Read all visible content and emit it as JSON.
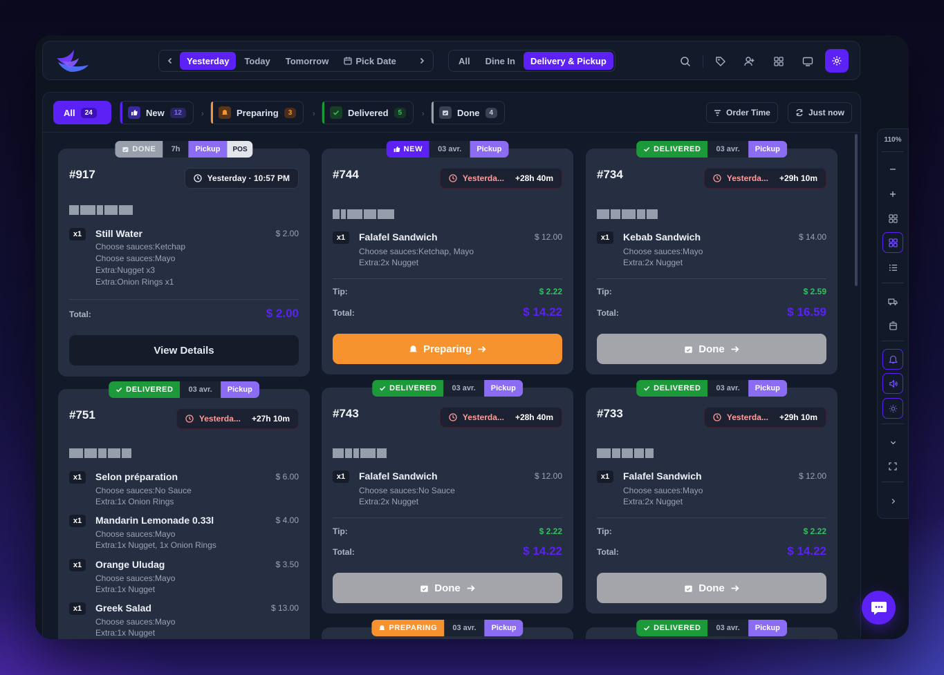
{
  "topbar": {
    "days": [
      {
        "label": "Yesterday",
        "active": true
      },
      {
        "label": "Today",
        "active": false
      },
      {
        "label": "Tomorrow",
        "active": false
      }
    ],
    "pick_date": "Pick Date",
    "modes": [
      {
        "label": "All",
        "active": false
      },
      {
        "label": "Dine In",
        "active": false
      },
      {
        "label": "Delivery & Pickup",
        "active": true
      }
    ]
  },
  "filters": {
    "all": {
      "label": "All",
      "count": "24"
    },
    "tabs": [
      {
        "label": "New",
        "count": "12",
        "color": "#5b21f5"
      },
      {
        "label": "Preparing",
        "count": "3",
        "color": "#f7932e"
      },
      {
        "label": "Delivered",
        "count": "5",
        "color": "#1c9a3a"
      },
      {
        "label": "Done",
        "count": "4",
        "color": "#9aa0ab"
      }
    ],
    "order_time": "Order Time",
    "just_now": "Just now"
  },
  "sidebar": {
    "zoom": "110%"
  },
  "cards": [
    {
      "number": "#917",
      "tags": {
        "status": "DONE",
        "time": "7h",
        "type": "Pickup",
        "source": "POS"
      },
      "time_label": "Yesterday · 10:57 PM",
      "items": [
        {
          "qty": "x1",
          "name": "Still Water",
          "price": "$ 2.00",
          "mods": [
            "Choose sauces:Ketchap",
            "Choose sauces:Mayo",
            "Extra:Nugget x3",
            "Extra:Onion Rings x1"
          ]
        }
      ],
      "total_label": "Total:",
      "total": "$ 2.00",
      "action": "View Details"
    },
    {
      "number": "#744",
      "tags": {
        "status": "NEW",
        "time": "03 avr.",
        "type": "Pickup"
      },
      "time_label": "Yesterda...",
      "late": "+28h 40m",
      "items": [
        {
          "qty": "x1",
          "name": "Falafel Sandwich",
          "price": "$ 12.00",
          "mods": [
            "Choose sauces:Ketchap, Mayo",
            "Extra:2x Nugget"
          ]
        }
      ],
      "tip_label": "Tip:",
      "tip": "$ 2.22",
      "total_label": "Total:",
      "total": "$ 14.22",
      "action": "Preparing"
    },
    {
      "number": "#734",
      "tags": {
        "status": "DELIVERED",
        "time": "03 avr.",
        "type": "Pickup"
      },
      "time_label": "Yesterda...",
      "late": "+29h 10m",
      "items": [
        {
          "qty": "x1",
          "name": "Kebab Sandwich",
          "price": "$ 14.00",
          "mods": [
            "Choose sauces:Mayo",
            "Extra:2x Nugget"
          ]
        }
      ],
      "tip_label": "Tip:",
      "tip": "$ 2.59",
      "total_label": "Total:",
      "total": "$ 16.59",
      "action": "Done"
    },
    {
      "number": "#751",
      "tags": {
        "status": "DELIVERED",
        "time": "03 avr.",
        "type": "Pickup"
      },
      "time_label": "Yesterda...",
      "late": "+27h 10m",
      "items": [
        {
          "qty": "x1",
          "name": "Selon préparation",
          "price": "$ 6.00",
          "mods": [
            "Choose sauces:No Sauce",
            "Extra:1x Onion Rings"
          ]
        },
        {
          "qty": "x1",
          "name": "Mandarin Lemonade 0.33l",
          "price": "$ 4.00",
          "mods": [
            "Choose sauces:Mayo",
            "Extra:1x Nugget, 1x Onion Rings"
          ]
        },
        {
          "qty": "x1",
          "name": "Orange Uludag",
          "price": "$ 3.50",
          "mods": [
            "Choose sauces:Mayo",
            "Extra:1x Nugget"
          ]
        },
        {
          "qty": "x1",
          "name": "Greek Salad",
          "price": "$ 13.00",
          "mods": [
            "Choose sauces:Mayo",
            "Extra:1x Nugget"
          ]
        }
      ]
    },
    {
      "number": "#743",
      "tags": {
        "status": "DELIVERED",
        "time": "03 avr.",
        "type": "Pickup"
      },
      "time_label": "Yesterda...",
      "late": "+28h 40m",
      "items": [
        {
          "qty": "x1",
          "name": "Falafel Sandwich",
          "price": "$ 12.00",
          "mods": [
            "Choose sauces:No Sauce",
            "Extra:2x Nugget"
          ]
        }
      ],
      "tip_label": "Tip:",
      "tip": "$ 2.22",
      "total_label": "Total:",
      "total": "$ 14.22",
      "action": "Done"
    },
    {
      "number": "#733",
      "tags": {
        "status": "DELIVERED",
        "time": "03 avr.",
        "type": "Pickup"
      },
      "time_label": "Yesterda...",
      "late": "+29h 10m",
      "items": [
        {
          "qty": "x1",
          "name": "Falafel Sandwich",
          "price": "$ 12.00",
          "mods": [
            "Choose sauces:Mayo",
            "Extra:2x Nugget"
          ]
        }
      ],
      "tip_label": "Tip:",
      "tip": "$ 2.22",
      "total_label": "Total:",
      "total": "$ 14.22",
      "action": "Done"
    },
    {
      "tags": {
        "status": "PREPARING",
        "time": "03 avr.",
        "type": "Pickup"
      }
    },
    {
      "tags": {
        "status": "DELIVERED",
        "time": "03 avr.",
        "type": "Pickup"
      }
    }
  ],
  "colors": {
    "accent": "#5b21f5",
    "preparing": "#f7932e",
    "delivered": "#1c9a3a",
    "done": "#a3a5aa",
    "tip": "#2ec35b"
  }
}
